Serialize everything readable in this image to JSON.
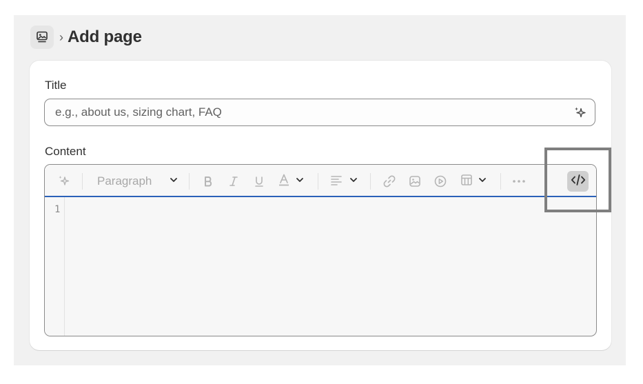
{
  "header": {
    "breadcrumb_icon": "pages-icon",
    "separator": "›",
    "title": "Add page"
  },
  "form": {
    "title_label": "Title",
    "title_placeholder": "e.g., about us, sizing chart, FAQ",
    "title_value": "",
    "content_label": "Content"
  },
  "editor": {
    "toolbar": {
      "ai_icon": "sparkle-icon",
      "format_select": "Paragraph",
      "tools": [
        "bold-icon",
        "italic-icon",
        "underline-icon",
        "text-color-icon",
        "align-icon",
        "link-icon",
        "image-icon",
        "video-icon",
        "table-icon",
        "more-icon",
        "code-view-icon"
      ]
    },
    "line_numbers": [
      "1"
    ],
    "content": ""
  },
  "colors": {
    "accent_underline": "#2a61b9",
    "code_button_active": "#cfcfcf",
    "highlight_box": "#7f7f7f"
  }
}
